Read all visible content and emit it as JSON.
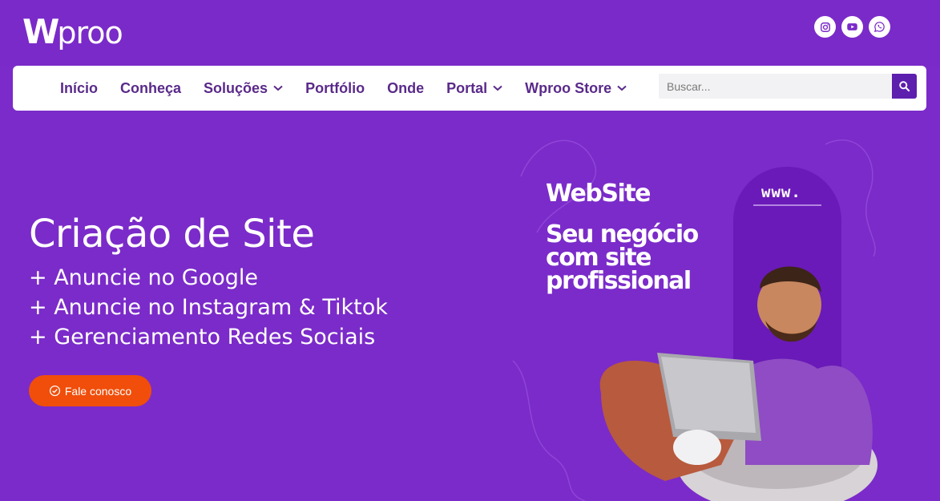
{
  "brand": {
    "logo_w": "W",
    "logo_rest": "proo"
  },
  "social": [
    {
      "name": "instagram-icon"
    },
    {
      "name": "youtube-icon"
    },
    {
      "name": "whatsapp-icon"
    }
  ],
  "nav": {
    "items": [
      {
        "label": "Início",
        "dropdown": false
      },
      {
        "label": "Conheça",
        "dropdown": false
      },
      {
        "label": "Soluções",
        "dropdown": true
      },
      {
        "label": "Portfólio",
        "dropdown": false
      },
      {
        "label": "Onde",
        "dropdown": false
      },
      {
        "label": "Portal",
        "dropdown": true
      },
      {
        "label": "Wproo Store",
        "dropdown": true
      }
    ],
    "search_placeholder": "Buscar..."
  },
  "hero": {
    "title": "Criação de Site",
    "lines": [
      "+ Anuncie no Google",
      "+ Anuncie no Instagram & Tiktok",
      "+ Gerenciamento Redes Sociais"
    ],
    "cta_label": "Fale conosco"
  },
  "banner": {
    "title": "WebSite",
    "subtitle_lines": [
      "Seu negócio",
      "com site",
      "profissional"
    ],
    "pill_text": "www."
  },
  "colors": {
    "background": "#7b2bc9",
    "nav_text": "#5a2a8a",
    "search_button": "#5d1fae",
    "cta": "#f04e0a"
  }
}
